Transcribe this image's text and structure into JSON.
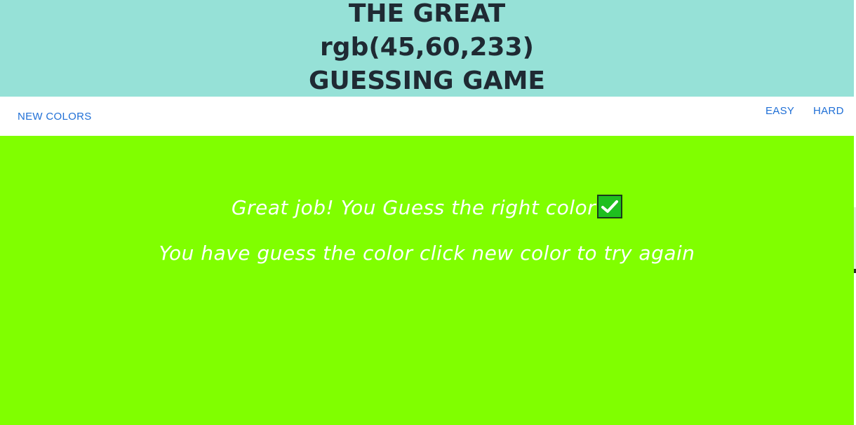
{
  "header": {
    "line1": "THE GREAT",
    "line2": "rgb(45,60,233)",
    "line3": "GUESSING GAME",
    "background": "#96e1d7"
  },
  "navbar": {
    "new_colors": "NEW COLORS",
    "easy": "EASY",
    "hard": "HARD",
    "link_color": "#1f6fd6"
  },
  "main": {
    "background": "#80ff00",
    "message_success": "Great job! You Guess the right color",
    "message_hint": "You have guess the color click new color to try again",
    "success_icon": "check-mark-icon"
  }
}
